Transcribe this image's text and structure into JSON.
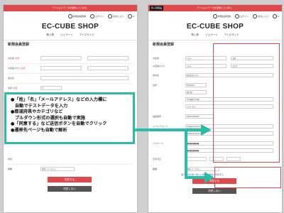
{
  "shop": {
    "notice": "デフォルトデータを使用しています。",
    "logo": "EC-CUBE SHOP",
    "nav": [
      "新入荷",
      "ジェラート",
      "アイスサンド"
    ],
    "util": [
      "新規会員登録",
      "ログイン",
      "お気に入り"
    ],
    "cart_count": "0",
    "preview_badge": "新入荷製品"
  },
  "form": {
    "title": "新規会員登録",
    "labels": {
      "name": "お名前",
      "kana": "お名前(カナ)",
      "company": "会社名",
      "address": "住所",
      "phone": "電話番号",
      "email": "メールアドレス",
      "password": "パスワード",
      "birthday": "生年月日",
      "gender": "性別",
      "job": "職業"
    },
    "required_mark": "必須",
    "zip_prefix": "〒",
    "job_placeholder": "選択してください",
    "submit_label": "同意する",
    "cancel_label": "同意しない",
    "agree_note": "個人情報の取り扱いに関する規約に同意する"
  },
  "filled": {
    "last_name": "テスト",
    "first_name": "太郎",
    "last_kana": "テスト",
    "first_kana": "タロウ",
    "company": "株式会社テスト",
    "zip": "1000001",
    "pref": "東京都",
    "city": "千代田区千代田",
    "street": "テストビル",
    "phone": "09012345678",
    "email": "test@example.com",
    "password": "●●●●●●●●"
  },
  "callout": {
    "lines": [
      "●「姓」「名」「メールアドレス」などの入力欄に",
      "自動でテストデータを入力",
      "●都道府県やカテゴリなど",
      "プルダウン形式の選択も自動で実施",
      "●「同意する」など送信ボタンを自動でクリック",
      "●遷移先ページも自動で解析"
    ]
  },
  "colors": {
    "brand_red": "#e0484c",
    "callout_teal": "#2bbca7"
  }
}
